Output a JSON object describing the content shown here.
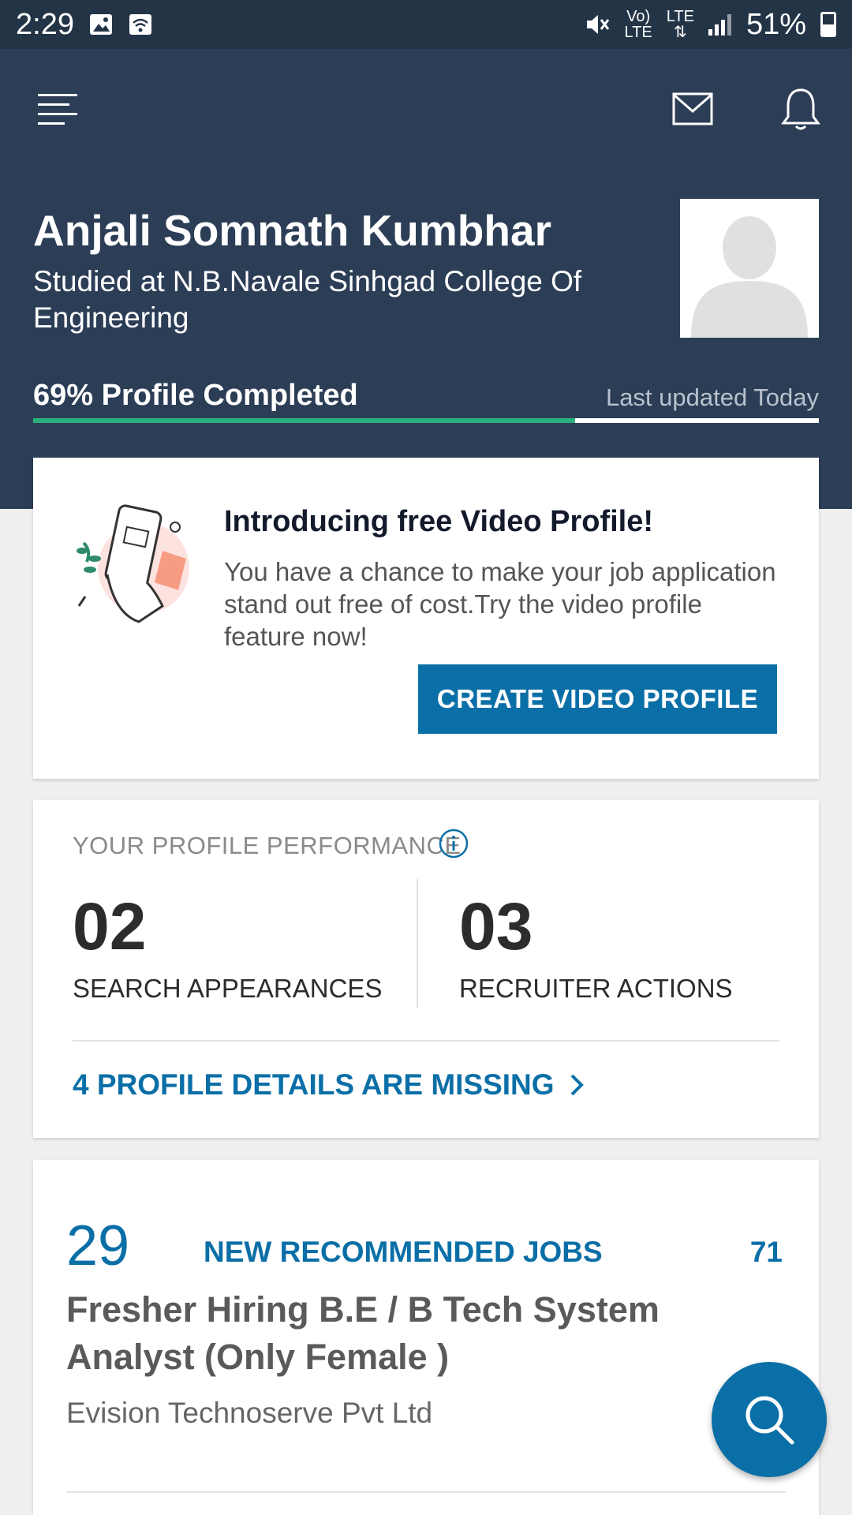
{
  "status_bar": {
    "time": "2:29",
    "net_top": "Vo)",
    "net_bottom": "LTE",
    "lte_label": "LTE",
    "battery": "51%"
  },
  "profile": {
    "name": "Anjali Somnath Kumbhar",
    "studied": "Studied at N.B.Navale Sinhgad College Of Engineering",
    "completion_label": "69% Profile Completed",
    "completion_fraction": 0.69,
    "last_updated": "Last updated Today",
    "accent_color": "#2ab07c"
  },
  "video_card": {
    "title": "Introducing free Video Profile!",
    "description": "You have a chance to make your job application stand out free of cost.Try the video profile feature now!",
    "button_label": "CREATE VIDEO PROFILE"
  },
  "performance": {
    "title": "YOUR PROFILE PERFORMANCE",
    "search_value": "02",
    "search_label": "SEARCH APPEARANCES",
    "recruiter_value": "03",
    "recruiter_label": "RECRUITER ACTIONS",
    "missing_label": "4 PROFILE DETAILS ARE MISSING"
  },
  "jobs": {
    "count": "29",
    "label": "NEW RECOMMENDED JOBS",
    "total": "71",
    "job_title": "Fresher Hiring B.E / B Tech System Analyst (Only Female )",
    "company": "Evision Technoserve Pvt Ltd"
  },
  "colors": {
    "header_bg": "#2c3e56",
    "primary": "#0b6fa7"
  }
}
